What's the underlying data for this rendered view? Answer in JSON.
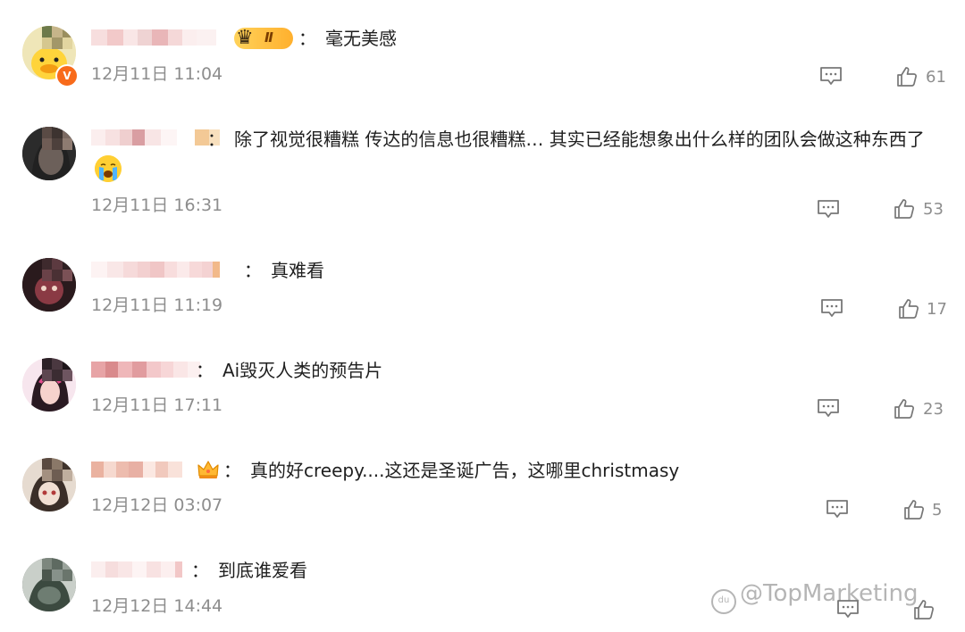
{
  "comments": [
    {
      "text": "毫无美感",
      "separator": "：",
      "time": "12月11日 11:04",
      "likes": "61",
      "badge_level": "Ⅱ",
      "avatar_icon": "duck-avatar",
      "verified_mark": "V"
    },
    {
      "text": "除了视觉很糟糕 传达的信息也很糟糕… 其实已经能想象出什么样的团队会做这种东西了",
      "separator": "：",
      "time": "12月11日 16:31",
      "likes": "53",
      "emoji_icon": "crying-face-icon"
    },
    {
      "text": "真难看",
      "separator": "：",
      "time": "12月11日 11:19",
      "likes": "17"
    },
    {
      "text": "Ai毁灭人类的预告片",
      "separator": "：",
      "time": "12月11日 17:11",
      "likes": "23"
    },
    {
      "text": "真的好creepy....这还是圣诞广告，这哪里christmasy",
      "separator": "：",
      "time": "12月12日 03:07",
      "likes": "5",
      "badge_icon": "crown-icon"
    },
    {
      "text": "到底谁爱看",
      "separator": "：",
      "time": "12月12日 14:44",
      "likes": ""
    }
  ],
  "watermark": {
    "text": "@TopMarketing",
    "logo_text": "du"
  },
  "icons": {
    "reply": "comment-icon",
    "like": "thumbs-up-icon"
  },
  "colors": {
    "timestamp": "#8d8d8d",
    "verified": "#f86b1b",
    "badge_gold": "#ffc23d"
  }
}
